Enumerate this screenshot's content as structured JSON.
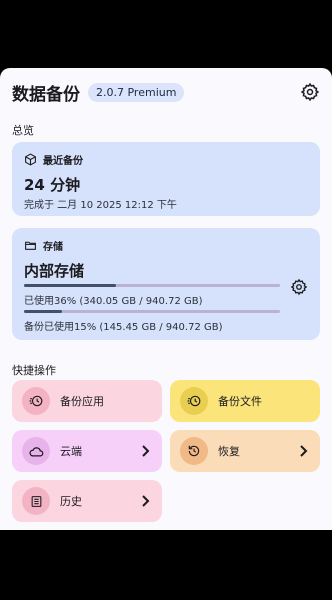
{
  "header": {
    "title": "数据备份",
    "version": "2.0.7 Premium"
  },
  "overview": {
    "section_label": "总览",
    "recent": {
      "title": "最近备份",
      "value": "24 分钟",
      "completed": "完成于 二月 10 2025 12:12 下午"
    },
    "storage": {
      "title": "存储",
      "location": "内部存储",
      "used_text": "已使用36% (340.05 GB / 940.72 GB)",
      "used_fraction": 0.36,
      "backup_text": "备份已使用15% (145.45 GB / 940.72 GB)",
      "backup_fraction": 0.15
    }
  },
  "quick": {
    "section_label": "快捷操作",
    "actions": [
      {
        "label": "备份应用",
        "icon": "app-backup-icon",
        "bg": "#fbd5e0",
        "circle": "#f3b3c5"
      },
      {
        "label": "备份文件",
        "icon": "file-backup-icon",
        "bg": "#fbe57a",
        "circle": "#e8cf52"
      },
      {
        "label": "云端",
        "icon": "cloud-icon",
        "bg": "#f6d0f8",
        "circle": "#e7b3ea"
      },
      {
        "label": "恢复",
        "icon": "restore-icon",
        "bg": "#fbdcb8",
        "circle": "#f0b985"
      },
      {
        "label": "历史",
        "icon": "history-icon",
        "bg": "#fbd5e0",
        "circle": "#f3b3c5"
      }
    ]
  }
}
